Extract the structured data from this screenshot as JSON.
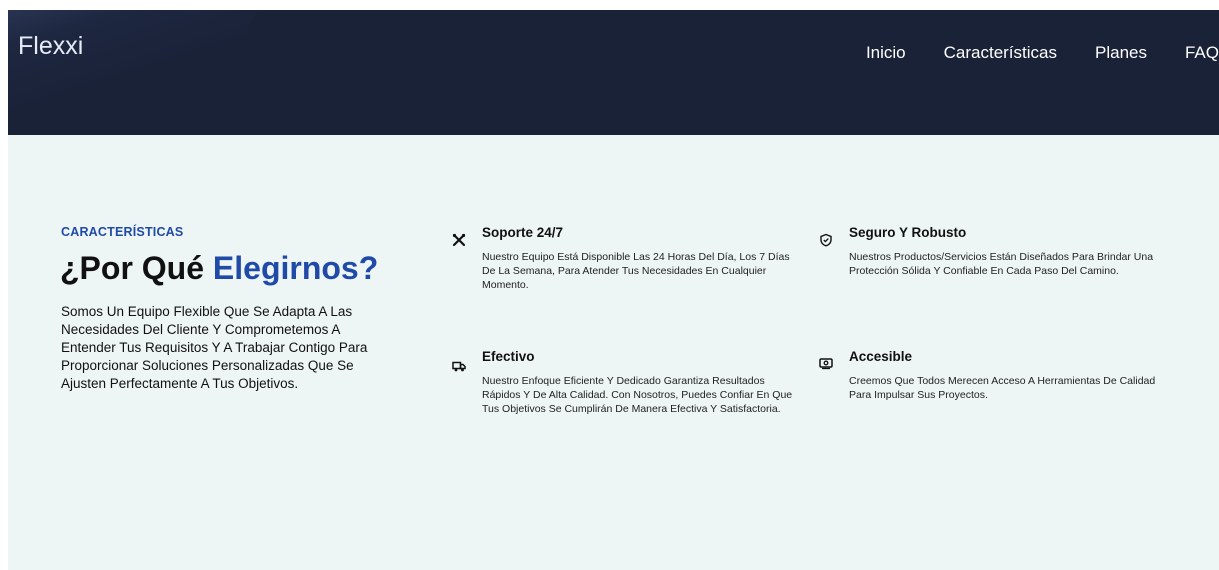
{
  "header": {
    "brand": "Flexxi",
    "nav": [
      "Inicio",
      "Características",
      "Planes",
      "FAQ"
    ]
  },
  "hero": {
    "overline": "CARACTERÍSTICAS",
    "heading_prefix": "¿Por Qué ",
    "heading_accent": "Elegirnos?",
    "description": "Somos Un Equipo Flexible Que Se Adapta A Las Necesidades Del Cliente Y Comprometemos A Entender Tus Requisitos Y A Trabajar Contigo Para Proporcionar Soluciones Personalizadas Que Se Ajusten Perfectamente A Tus Objetivos."
  },
  "features": [
    {
      "icon": "tools-icon",
      "title": "Soporte 24/7",
      "text": "Nuestro Equipo Está Disponible Las 24 Horas Del Día, Los 7 Días De La Semana, Para Atender Tus Necesidades En Cualquier Momento."
    },
    {
      "icon": "shield-icon",
      "title": "Seguro Y Robusto",
      "text": "Nuestros Productos/Servicios Están Diseñados Para Brindar Una Protección Sólida Y Confiable En Cada Paso Del Camino."
    },
    {
      "icon": "truck-icon",
      "title": "Efectivo",
      "text": "Nuestro Enfoque Eficiente Y Dedicado Garantiza Resultados Rápidos Y De Alta Calidad. Con Nosotros, Puedes Confiar En Que Tus Objetivos Se Cumplirán De Manera Efectiva Y Satisfactoria."
    },
    {
      "icon": "money-icon",
      "title": "Accesible",
      "text": "Creemos Que Todos Merecen Acceso A Herramientas De Calidad Para Impulsar Sus Proyectos."
    }
  ],
  "colors": {
    "navbar": "#1a2238",
    "accent": "#1f4aa8",
    "background": "#eef5f5"
  }
}
